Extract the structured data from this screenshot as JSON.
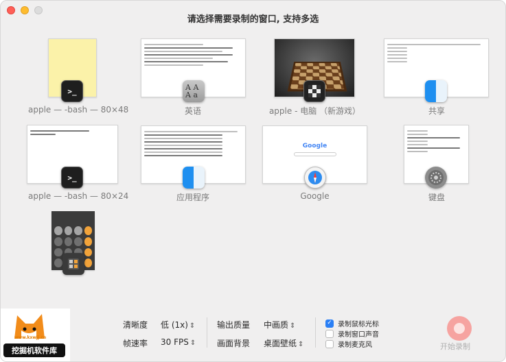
{
  "window": {
    "title": "请选择需要录制的窗口, 支持多选"
  },
  "windows": [
    {
      "label": "apple — -bash — 80×48",
      "app_icon": "terminal-icon"
    },
    {
      "label": "英语",
      "app_icon": "font-book-icon"
    },
    {
      "label": "apple - 电脑 （新游戏）",
      "app_icon": "chess-icon"
    },
    {
      "label": "共享",
      "app_icon": "finder-icon"
    },
    {
      "label": "apple — -bash — 80×24",
      "app_icon": "terminal-icon"
    },
    {
      "label": "应用程序",
      "app_icon": "finder-icon"
    },
    {
      "label": "Google",
      "app_icon": "safari-icon"
    },
    {
      "label": "键盘",
      "app_icon": "system-settings-icon"
    },
    {
      "label": "",
      "app_icon": "calculator-icon"
    }
  ],
  "thumbnails": {
    "google_logo_text": "Google",
    "font_icon_text": "A A A a"
  },
  "settings": {
    "resolution_label": "清晰度",
    "resolution_value": "低 (1x)",
    "framerate_label": "帧速率",
    "framerate_value": "30 FPS",
    "quality_label": "输出质量",
    "quality_value": "中画质",
    "background_label": "画面背景",
    "background_value": "桌面壁纸"
  },
  "options": [
    {
      "label": "录制鼠标光标",
      "checked": true
    },
    {
      "label": "录制窗口声音",
      "checked": false
    },
    {
      "label": "录制麦克风",
      "checked": false
    }
  ],
  "record": {
    "label": "开始录制"
  },
  "watermark": {
    "url": "www.kxwjj.cn",
    "text": "挖掘机软件库"
  },
  "colors": {
    "checkbox_accent": "#2a7ff5",
    "record_button": "#f6a3a0",
    "close": "#ff5f57",
    "minimize": "#febc2e"
  }
}
